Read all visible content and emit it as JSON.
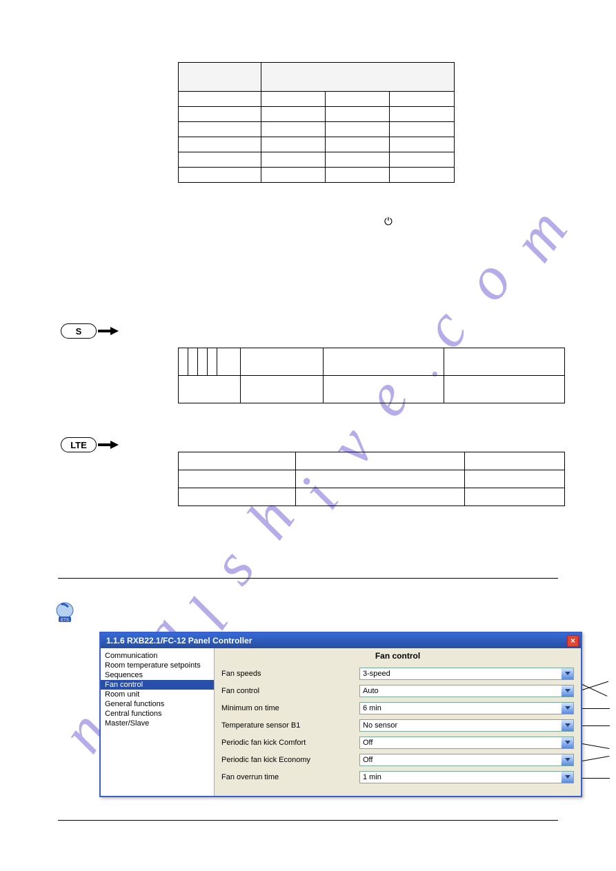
{
  "watermark": {
    "text": "manualshive.com"
  },
  "badges": {
    "s": "S",
    "lte": "LTE"
  },
  "power_glyph": "⏻",
  "etsWindow": {
    "title": "1.1.6 RXB22.1/FC-12 Panel Controller",
    "panelTitle": "Fan control",
    "sidebar": [
      "Communication",
      "Room temperature setpoints",
      "Sequences",
      "Fan control",
      "Room unit",
      "General functions",
      "Central functions",
      "Master/Slave"
    ],
    "fields": [
      {
        "label": "Fan speeds",
        "value": "3-speed"
      },
      {
        "label": "Fan control",
        "value": "Auto"
      },
      {
        "label": "Minimum on time",
        "value": "6 min"
      },
      {
        "label": "Temperature sensor B1",
        "value": "No sensor"
      },
      {
        "label": "Periodic fan kick Comfort",
        "value": "Off"
      },
      {
        "label": "Periodic fan kick Economy",
        "value": "Off"
      },
      {
        "label": "Fan overrun time",
        "value": "1 min"
      }
    ]
  }
}
